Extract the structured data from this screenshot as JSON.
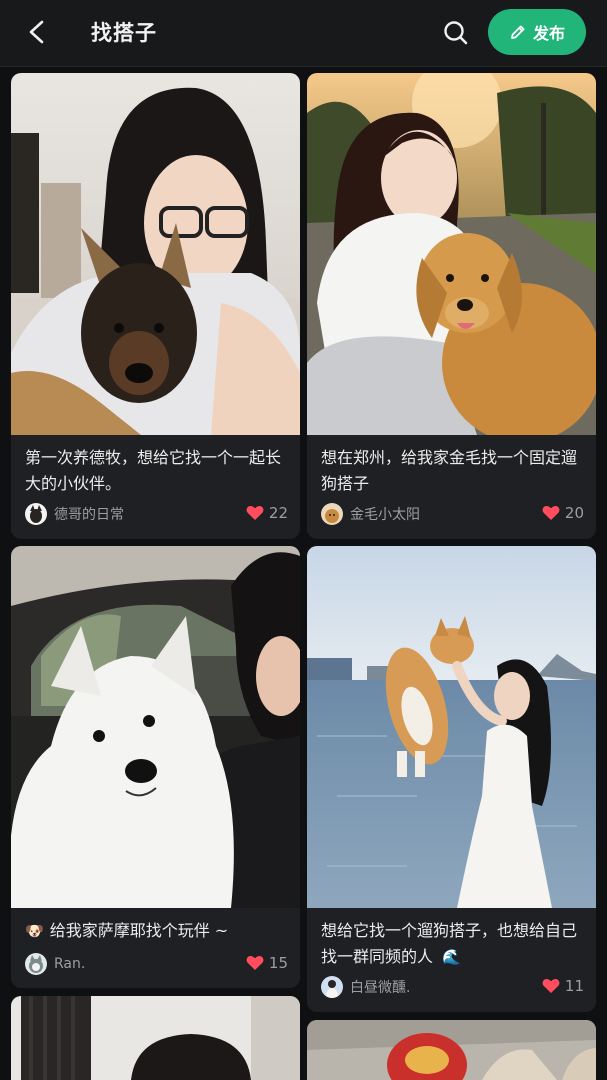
{
  "header": {
    "title": "找搭子",
    "publish_label": "发布"
  },
  "posts": [
    {
      "title": "第一次养德牧，想给它找一个一起长大的小伙伴。",
      "author": "德哥的日常",
      "likes": "22"
    },
    {
      "title": "想在郑州，给我家金毛找一个固定遛狗搭子",
      "author": "金毛小太阳",
      "likes": "20"
    },
    {
      "title": "给我家萨摩耶找个玩伴 ~",
      "author": "Ran.",
      "likes": "15"
    },
    {
      "title": "想给它找一个遛狗搭子，也想给自己找一群同频的人",
      "author": "白昼微醺.",
      "likes": "11"
    }
  ],
  "icons": {
    "back": "chevron-left-icon",
    "search": "search-icon",
    "publish": "pencil-icon",
    "likes": "heart-icon"
  },
  "colors": {
    "accent": "#22b57a",
    "heart": "#ff4d5e",
    "background": "#0f1011",
    "card": "#1f2023"
  }
}
